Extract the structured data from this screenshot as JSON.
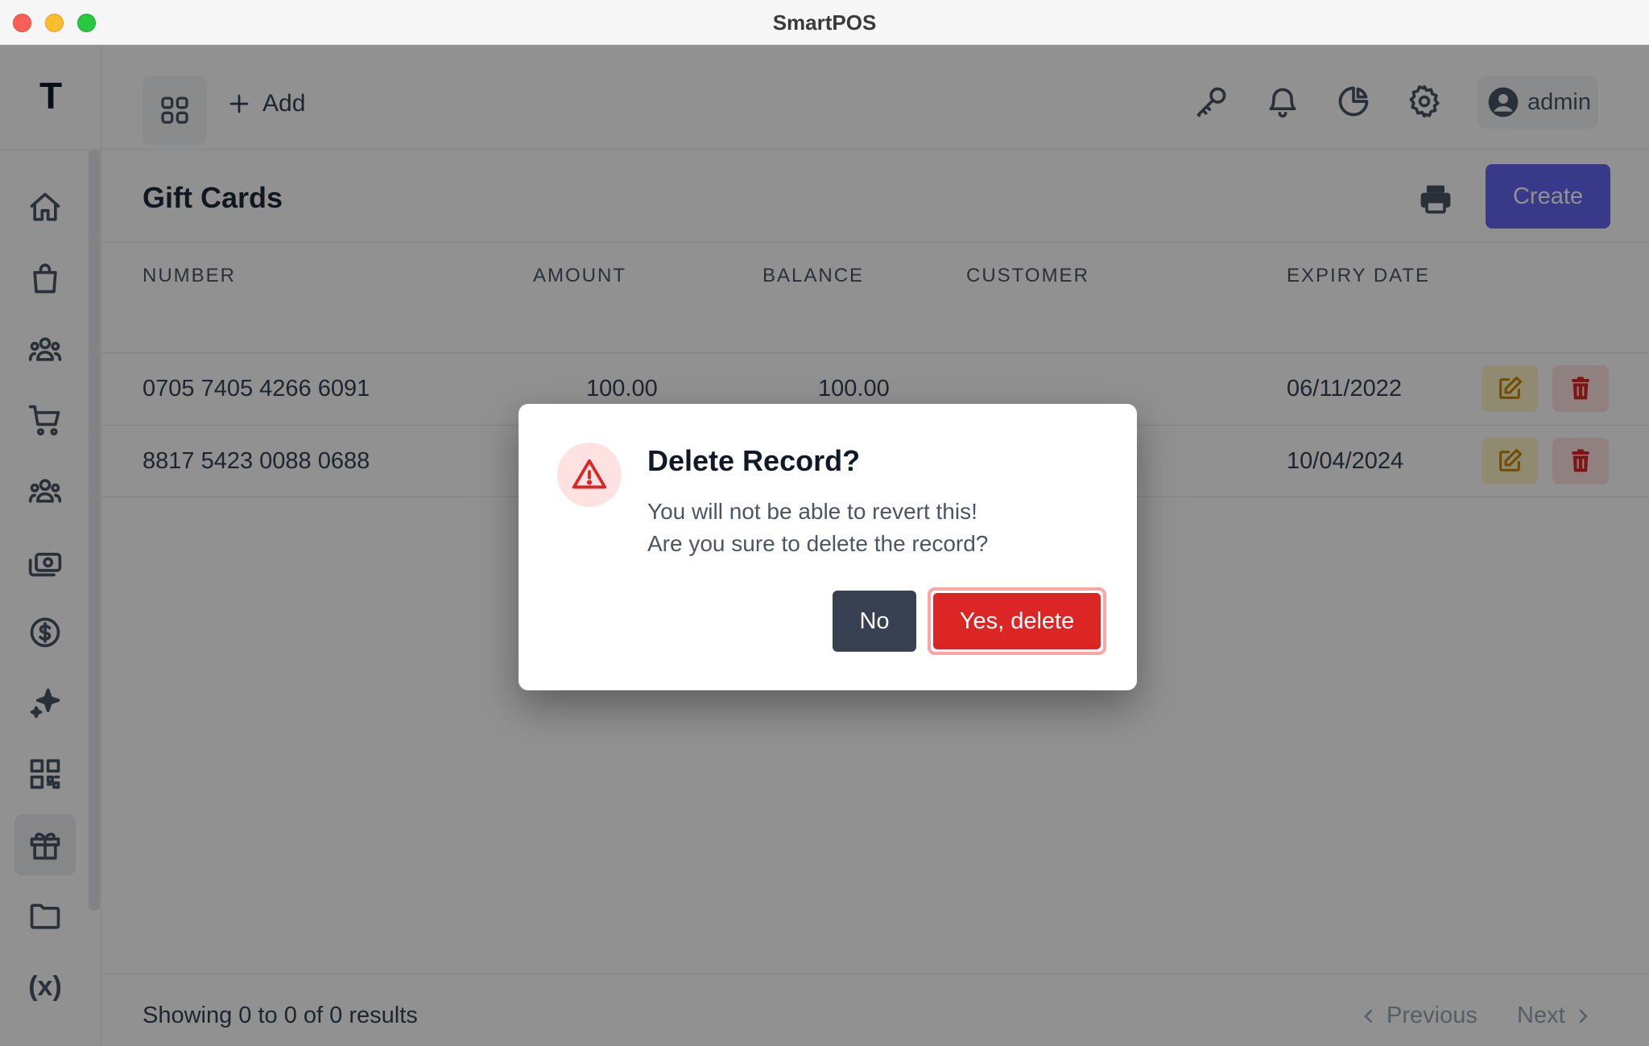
{
  "window": {
    "title": "SmartPOS"
  },
  "app": {
    "logo": "T"
  },
  "topbar": {
    "add_label": "Add",
    "user_name": "admin"
  },
  "sidebar": {
    "items": [
      {
        "icon": "home-icon"
      },
      {
        "icon": "shopping-bag-icon"
      },
      {
        "icon": "users-icon"
      },
      {
        "icon": "cart-icon"
      },
      {
        "icon": "users-group-icon"
      },
      {
        "icon": "cash-icon"
      },
      {
        "icon": "dollar-circle-icon"
      },
      {
        "icon": "sparkles-icon"
      },
      {
        "icon": "qr-code-icon"
      },
      {
        "icon": "gift-icon",
        "active": true
      },
      {
        "icon": "folder-icon"
      },
      {
        "icon": "variable-icon",
        "label": "(x)"
      }
    ]
  },
  "page": {
    "title": "Gift Cards",
    "create_label": "Create"
  },
  "table": {
    "headers": {
      "number": "NUMBER",
      "amount": "AMOUNT",
      "balance": "BALANCE",
      "customer": "CUSTOMER",
      "expiry": "EXPIRY DATE"
    },
    "rows": [
      {
        "number": "0705 7405 4266 6091",
        "amount": "100.00",
        "balance": "100.00",
        "customer": "",
        "expiry": "06/11/2022"
      },
      {
        "number": "8817 5423 0088 0688",
        "amount": "",
        "balance": "",
        "customer": "",
        "expiry": "10/04/2024"
      }
    ]
  },
  "footer": {
    "summary": "Showing 0 to 0 of 0 results",
    "previous_label": "Previous",
    "next_label": "Next"
  },
  "dialog": {
    "title": "Delete Record?",
    "line1": "You will not be able to revert this!",
    "line2": "Are you sure to delete the record?",
    "no_label": "No",
    "yes_label": "Yes, delete"
  },
  "colors": {
    "accent": "#6366f1",
    "danger": "#dc2626",
    "dark_button": "#374151"
  }
}
